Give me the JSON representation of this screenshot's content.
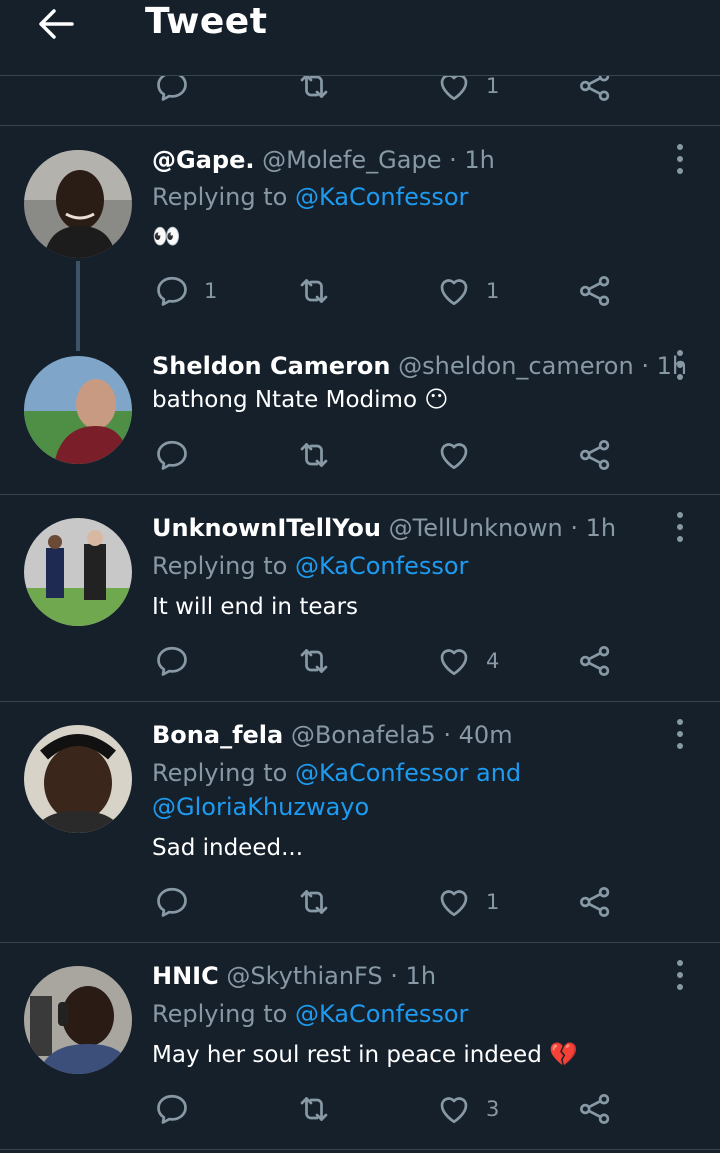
{
  "header": {
    "title": "Tweet"
  },
  "prev_tweet": {
    "likes": "1"
  },
  "tweets": [
    {
      "name": "@Gape.",
      "meta": "@Molefe_Gape · 1h",
      "reply_prefix": "Replying to ",
      "reply_line1": "@KaConfessor",
      "reply_line2": "",
      "text": "👀",
      "replies": "1",
      "retweets": "",
      "likes": "1"
    },
    {
      "name": "Sheldon Cameron",
      "meta": "@sheldon_cameron · 1h",
      "reply_prefix": "",
      "reply_line1": "",
      "reply_line2": "",
      "text": "bathong Ntate Modimo 😶",
      "replies": "",
      "retweets": "",
      "likes": ""
    },
    {
      "name": "UnknownITellYou",
      "meta": "@TellUnknown · 1h",
      "reply_prefix": "Replying to ",
      "reply_line1": "@KaConfessor",
      "reply_line2": "",
      "text": "It will end in tears",
      "replies": "",
      "retweets": "",
      "likes": "4"
    },
    {
      "name": "Bona_fela",
      "meta": "@Bonafela5 · 40m",
      "reply_prefix": "Replying to ",
      "reply_line1": "@KaConfessor and",
      "reply_line2": "@GloriaKhuzwayo",
      "text": "Sad indeed...",
      "replies": "",
      "retweets": "",
      "likes": "1"
    },
    {
      "name": "HNIC",
      "meta": "@SkythianFS · 1h",
      "reply_prefix": "Replying to ",
      "reply_line1": "@KaConfessor",
      "reply_line2": "",
      "text": "May her soul rest in peace indeed 💔",
      "replies": "",
      "retweets": "",
      "likes": "3"
    }
  ],
  "icons": {
    "back": "arrow-left-icon",
    "reply": "reply-icon",
    "retweet": "retweet-icon",
    "like": "heart-icon",
    "share": "share-icon",
    "more": "more-vertical-icon"
  },
  "colors": {
    "background": "#15202b",
    "divider": "#38444d",
    "secondary_text": "#8899a6",
    "link": "#1d9bf0"
  }
}
